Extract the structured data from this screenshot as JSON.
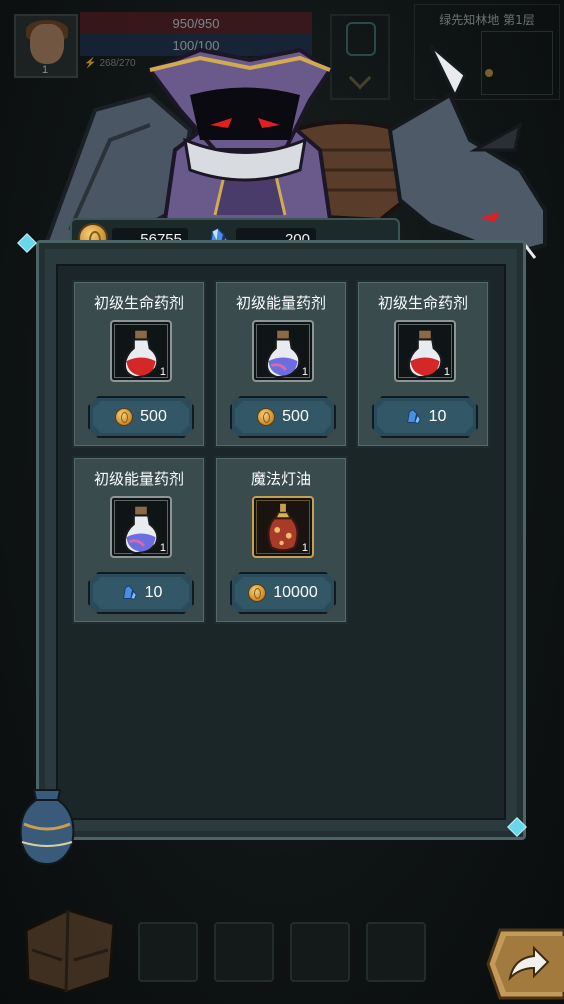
{
  "hud": {
    "player_level": "1",
    "hp_text": "950/950",
    "mp_text": "100/100",
    "energy_text": "268/270",
    "minimap_title": "绿先知林地 第1层"
  },
  "currency": {
    "gold_amount": "56755",
    "crystal_amount": "200"
  },
  "shop": {
    "items": [
      {
        "name": "初级生命药剂",
        "quantity": "1",
        "price": "500",
        "currency_icon": "gold-coin-icon",
        "potion": "red-potion-icon"
      },
      {
        "name": "初级能量药剂",
        "quantity": "1",
        "price": "500",
        "currency_icon": "gold-coin-icon",
        "potion": "blue-potion-icon"
      },
      {
        "name": "初级生命药剂",
        "quantity": "1",
        "price": "10",
        "currency_icon": "crystal-icon",
        "potion": "red-potion-icon"
      },
      {
        "name": "初级能量药剂",
        "quantity": "1",
        "price": "10",
        "currency_icon": "crystal-icon",
        "potion": "blue-potion-icon"
      },
      {
        "name": "魔法灯油",
        "quantity": "1",
        "price": "10000",
        "currency_icon": "gold-coin-icon",
        "potion": "lamp-oil-icon"
      }
    ]
  },
  "colors": {
    "panel": "#2b3a3c",
    "card": "#3a4b4d",
    "button": "#325868",
    "gold": "#e6b04a",
    "crystal": "#5aa8f0"
  }
}
